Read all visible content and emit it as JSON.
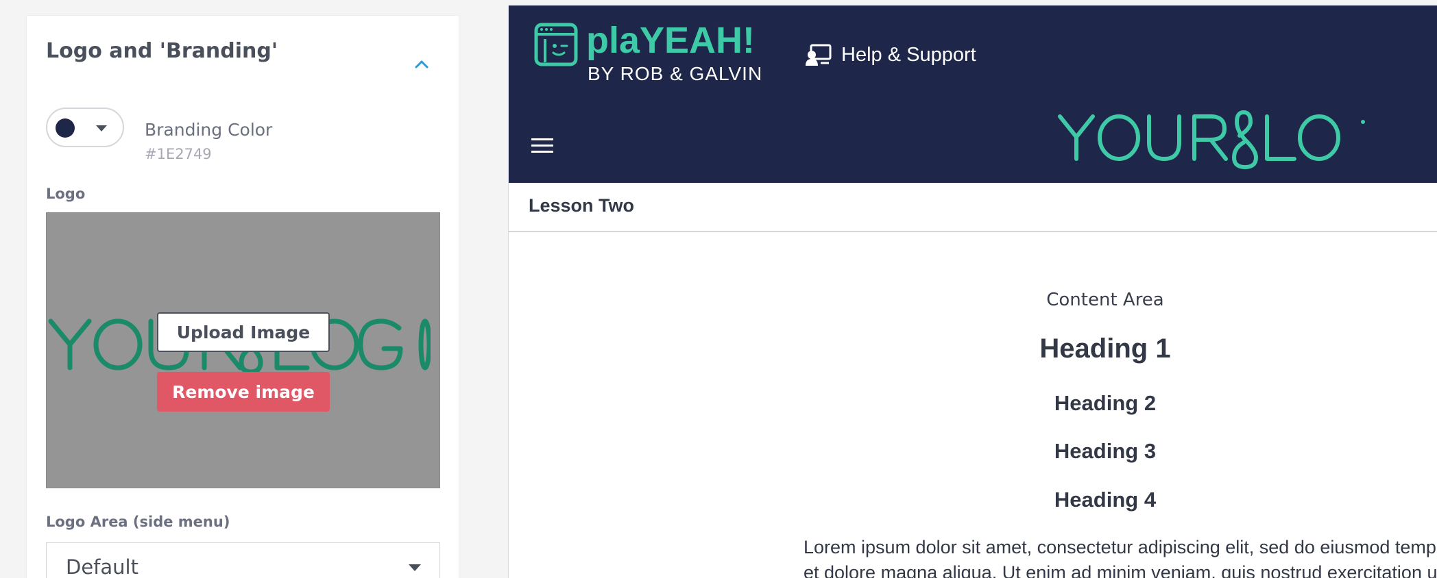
{
  "panel": {
    "title": "Logo and 'Branding'",
    "branding": {
      "label": "Branding Color",
      "hex": "#1E2749",
      "swatch_color": "#1E2749"
    },
    "logo_label": "Logo",
    "upload_label": "Upload Image",
    "remove_label": "Remove image",
    "logo_area_label": "Logo Area (side menu)",
    "logo_area_value": "Default"
  },
  "preview": {
    "brand_name": "plaYEAH!",
    "brand_sub": "BY ROB & GALVIN",
    "help_label": "Help & Support",
    "lesson_title": "Lesson Two",
    "content_area_label": "Content Area",
    "heading1": "Heading 1",
    "heading2": "Heading 2",
    "heading3": "Heading 3",
    "heading4": "Heading 4",
    "lorem_line1": "Lorem ipsum dolor sit amet, consectetur adipiscing elit, sed do eiusmod temp",
    "lorem_line2": "et dolore magna aliqua. Ut enim ad minim veniam, quis nostrud exercitation u"
  },
  "colors": {
    "brand_navy": "#1E2749",
    "brand_teal": "#3ec9a7",
    "remove_red": "#e05766",
    "logo_preview_green": "#1a8a68"
  },
  "icons": [
    "chevron-up-icon",
    "caret-down-icon",
    "support-icon",
    "hamburger-menu-icon",
    "playeah-face-icon"
  ]
}
